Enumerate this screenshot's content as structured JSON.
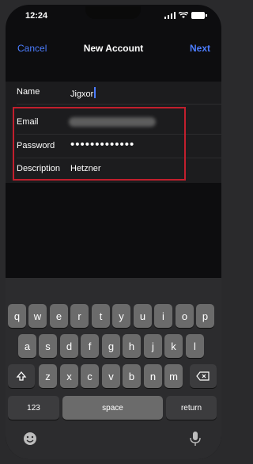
{
  "status": {
    "time": "12:24",
    "icons": [
      "signal-icon",
      "wifi-icon",
      "battery-icon"
    ]
  },
  "nav": {
    "cancel": "Cancel",
    "title": "New Account",
    "next": "Next"
  },
  "form": {
    "name_label": "Name",
    "name_value": "Jigxor",
    "email_label": "Email",
    "email_value": "",
    "password_label": "Password",
    "password_value": "•••••••••••••",
    "description_label": "Description",
    "description_value": "Hetzner"
  },
  "keyboard": {
    "row1": [
      "q",
      "w",
      "e",
      "r",
      "t",
      "y",
      "u",
      "i",
      "o",
      "p"
    ],
    "row2": [
      "a",
      "s",
      "d",
      "f",
      "g",
      "h",
      "j",
      "k",
      "l"
    ],
    "row3": [
      "z",
      "x",
      "c",
      "v",
      "b",
      "n",
      "m"
    ],
    "numbers": "123",
    "space": "space",
    "return": "return"
  },
  "colors": {
    "accent": "#4c7dff",
    "highlight": "#c21f2d"
  }
}
